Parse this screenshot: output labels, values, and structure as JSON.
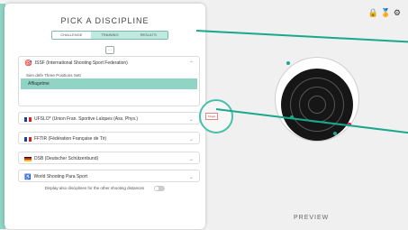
{
  "title": "PICK A DISCIPLINE",
  "tabs": [
    "CHALLENGE",
    "TRAINING",
    "RESULTS"
  ],
  "small_button": "...",
  "groups": [
    {
      "label": "ISSF (International Shooting Sport Federation)",
      "expanded": true,
      "subtitle": "Sien defe Three Positions Sett",
      "selected": "Affiagetme"
    },
    {
      "label": "UFSLO* (Union Fran. Sportive Laïques (Ass. Phys.)",
      "expanded": false
    },
    {
      "label": "FFTIR (Fédération Française de Tir)",
      "expanded": false
    },
    {
      "label": "DSB (Deutscher Schützenbund)",
      "expanded": false
    },
    {
      "label": "World Shooting Para Sport",
      "expanded": false
    }
  ],
  "toggle_text": "Display also disciplines for the other shooting distances",
  "preview_label": "PREVIEW",
  "edge_tag": "Target",
  "colors": {
    "accent": "#8fd4c4",
    "pointer": "#1aa88a"
  },
  "icons": [
    "lock-icon",
    "medal-icon",
    "gear-icon"
  ]
}
